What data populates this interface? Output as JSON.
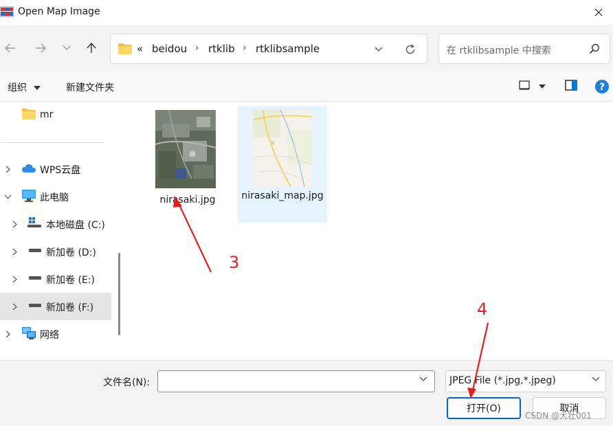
{
  "window": {
    "title": "Open Map Image"
  },
  "navigation": {
    "breadcrumb": {
      "overflow": "«",
      "items": [
        "beidou",
        "rtklib",
        "rtklibsample"
      ]
    },
    "search_placeholder": "在 rtklibsample 中搜索"
  },
  "toolbar": {
    "organize": "组织",
    "new_folder": "新建文件夹"
  },
  "sidebar": {
    "quick_item": "mr",
    "items": [
      {
        "label": "WPS云盘",
        "icon": "cloud-icon"
      },
      {
        "label": "此电脑",
        "icon": "computer-icon"
      },
      {
        "label": "本地磁盘 (C:)",
        "icon": "windows-drive-icon"
      },
      {
        "label": "新加卷 (D:)",
        "icon": "drive-icon"
      },
      {
        "label": "新加卷 (E:)",
        "icon": "drive-icon"
      },
      {
        "label": "新加卷 (F:)",
        "icon": "drive-icon",
        "selected": true
      },
      {
        "label": "网络",
        "icon": "network-icon"
      }
    ]
  },
  "files": [
    {
      "name": "nirasaki.jpg"
    },
    {
      "name": "nirasaki_map.jpg",
      "selected": true
    }
  ],
  "footer": {
    "filename_label": "文件名(N):",
    "filename_value": "",
    "filetype": "JPEG File (*.jpg,*.jpeg)",
    "open_button": "打开(O)",
    "cancel_button": "取消"
  },
  "annotations": {
    "step3": "3",
    "step4": "4",
    "color": "#e02020"
  },
  "watermark": "CSDN @大壮001"
}
